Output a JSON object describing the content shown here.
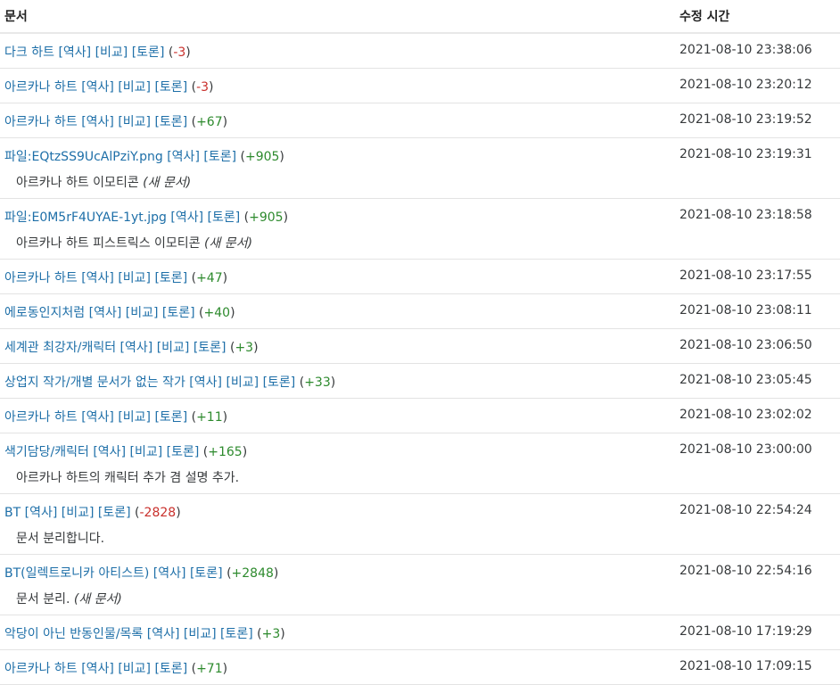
{
  "header": {
    "doc": "문서",
    "time": "수정 시간"
  },
  "labels": {
    "history": "[역사]",
    "compare": "[비교]",
    "discuss": "[토론]",
    "new_doc": "(새 문서)"
  },
  "rows": [
    {
      "title": "다크 하트",
      "compare": true,
      "change": "-3",
      "sign": "neg",
      "time": "2021-08-10 23:38:06",
      "log": null,
      "new": false
    },
    {
      "title": "아르카나 하트",
      "compare": true,
      "change": "-3",
      "sign": "neg",
      "time": "2021-08-10 23:20:12",
      "log": null,
      "new": false
    },
    {
      "title": "아르카나 하트",
      "compare": true,
      "change": "+67",
      "sign": "pos",
      "time": "2021-08-10 23:19:52",
      "log": null,
      "new": false
    },
    {
      "title": "파일:EQtzSS9UcAlPziY.png",
      "compare": false,
      "change": "+905",
      "sign": "pos",
      "time": "2021-08-10 23:19:31",
      "log": "아르카나 하트 이모티콘",
      "new": true
    },
    {
      "title": "파일:E0M5rF4UYAE-1yt.jpg",
      "compare": false,
      "change": "+905",
      "sign": "pos",
      "time": "2021-08-10 23:18:58",
      "log": "아르카나 하트 피스트릭스 이모티콘",
      "new": true
    },
    {
      "title": "아르카나 하트",
      "compare": true,
      "change": "+47",
      "sign": "pos",
      "time": "2021-08-10 23:17:55",
      "log": null,
      "new": false
    },
    {
      "title": "에로동인지처럼",
      "compare": true,
      "change": "+40",
      "sign": "pos",
      "time": "2021-08-10 23:08:11",
      "log": null,
      "new": false
    },
    {
      "title": "세계관 최강자/캐릭터",
      "compare": true,
      "change": "+3",
      "sign": "pos",
      "time": "2021-08-10 23:06:50",
      "log": null,
      "new": false
    },
    {
      "title": "상업지 작가/개별 문서가 없는 작가",
      "compare": true,
      "change": "+33",
      "sign": "pos",
      "time": "2021-08-10 23:05:45",
      "log": null,
      "new": false
    },
    {
      "title": "아르카나 하트",
      "compare": true,
      "change": "+11",
      "sign": "pos",
      "time": "2021-08-10 23:02:02",
      "log": null,
      "new": false
    },
    {
      "title": "색기담당/캐릭터",
      "compare": true,
      "change": "+165",
      "sign": "pos",
      "time": "2021-08-10 23:00:00",
      "log": "아르카나 하트의 캐릭터 추가 겸 설명 추가.",
      "new": false
    },
    {
      "title": "BT",
      "compare": true,
      "change": "-2828",
      "sign": "neg",
      "time": "2021-08-10 22:54:24",
      "log": "문서 분리합니다.",
      "new": false
    },
    {
      "title": "BT(일렉트로니카 아티스트)",
      "compare": false,
      "change": "+2848",
      "sign": "pos",
      "time": "2021-08-10 22:54:16",
      "log": "문서 분리.",
      "new": true
    },
    {
      "title": "악당이 아닌 반동인물/목록",
      "compare": true,
      "change": "+3",
      "sign": "pos",
      "time": "2021-08-10 17:19:29",
      "log": null,
      "new": false
    },
    {
      "title": "아르카나 하트",
      "compare": true,
      "change": "+71",
      "sign": "pos",
      "time": "2021-08-10 17:09:15",
      "log": null,
      "new": false
    }
  ]
}
